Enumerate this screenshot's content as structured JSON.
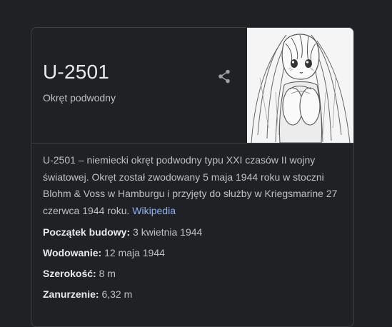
{
  "panel": {
    "title": "U-2501",
    "subtitle": "Okręt podwodny",
    "share_icon": "share-icon",
    "description": "U-2501 – niemiecki okręt podwodny typu XXI czasów II wojny światowej. Okręt został zwodowany 5 maja 1944 roku w stoczni Blohm & Voss w Hamburgu i przyjęty do służby w Kriegsmarine 27 czerwca 1944 roku.",
    "source_link": "Wikipedia",
    "facts": [
      {
        "key": "Początek budowy:",
        "value": "3 kwietnia 1944"
      },
      {
        "key": "Wodowanie:",
        "value": "12 maja 1944"
      },
      {
        "key": "Szerokość:",
        "value": "8 m"
      },
      {
        "key": "Zanurzenie:",
        "value": "6,32 m"
      }
    ]
  },
  "colors": {
    "background": "#202124",
    "border": "#3c4043",
    "title": "#e8eaed",
    "text": "#bdc1c6",
    "link": "#8ab4f8"
  }
}
